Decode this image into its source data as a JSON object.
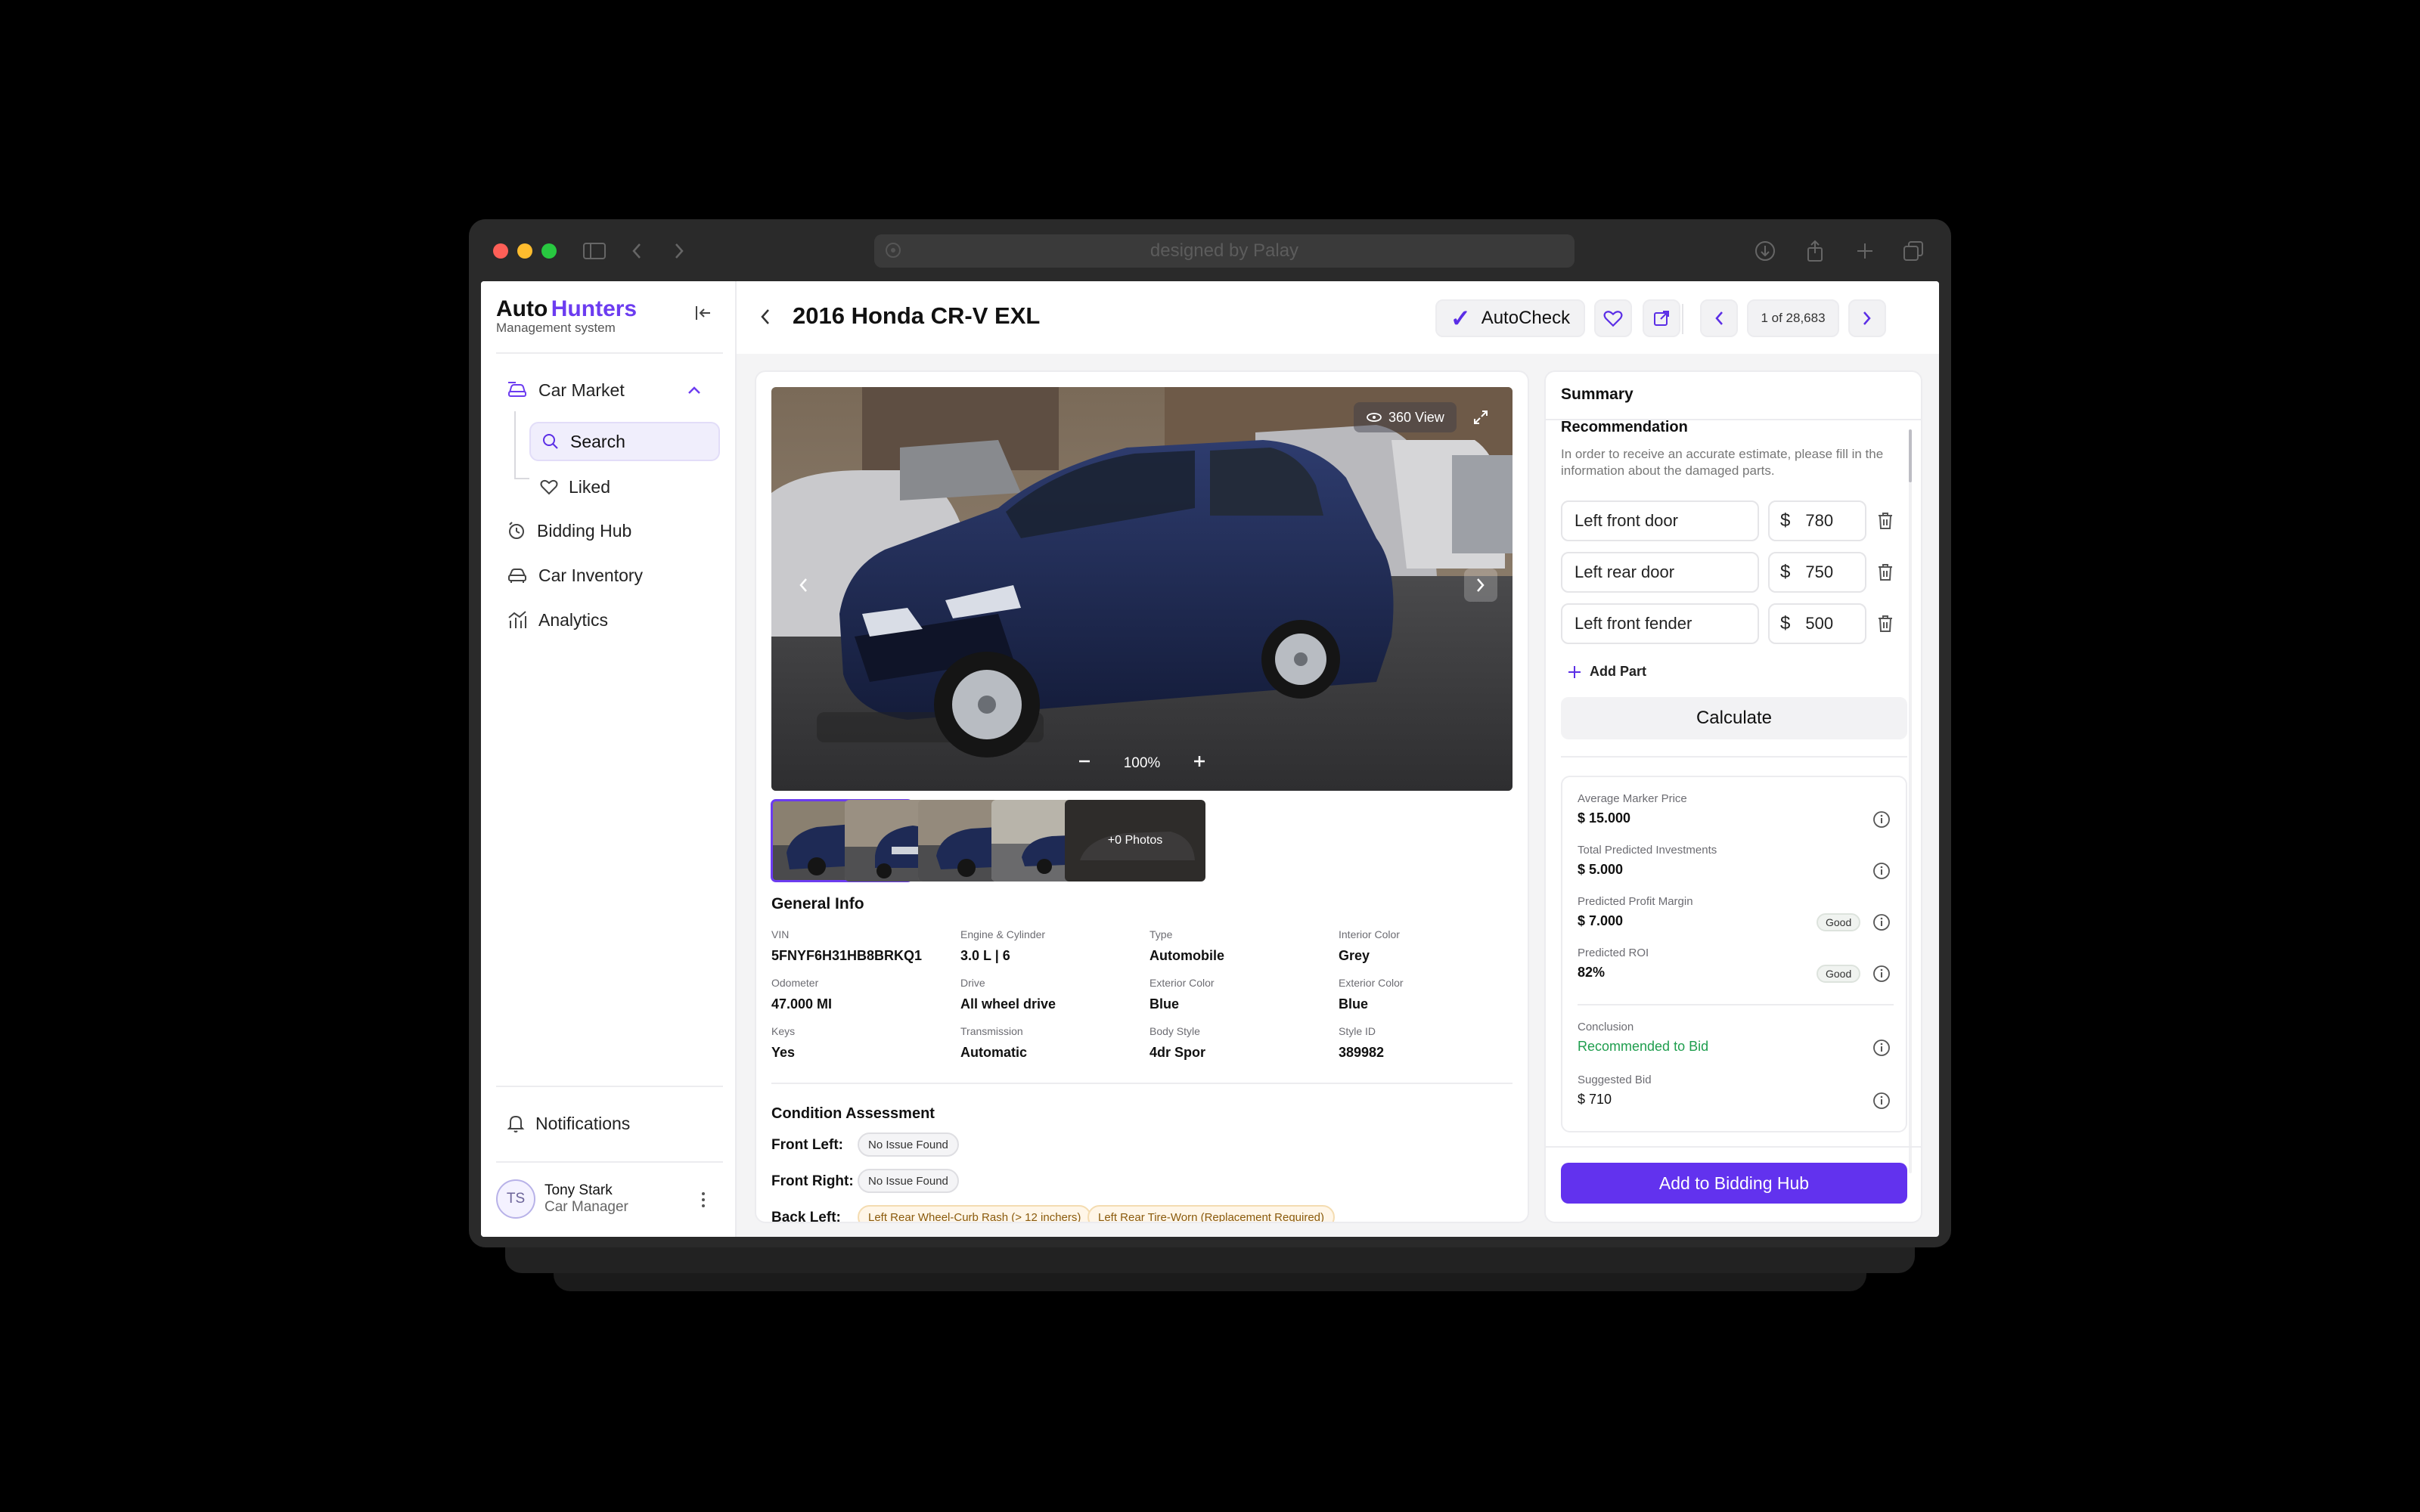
{
  "browser": {
    "url": "designed by Palay"
  },
  "brand": {
    "name_part1": "Auto",
    "name_part2": "Hunters",
    "subtitle": "Management system"
  },
  "nav": {
    "car_market": "Car Market",
    "search": "Search",
    "liked": "Liked",
    "bidding_hub": "Bidding Hub",
    "car_inventory": "Car Inventory",
    "analytics": "Analytics",
    "notifications": "Notifications"
  },
  "user": {
    "initials": "TS",
    "name": "Tony Stark",
    "role": "Car Manager"
  },
  "header": {
    "title": "2016 Honda CR-V EXL",
    "autocheck": "AutoCheck",
    "pager": "1 of 28,683"
  },
  "photo": {
    "view360": "360 View",
    "zoom": "100%",
    "more_photos": "+0 Photos"
  },
  "general_info": {
    "title": "General Info",
    "fields": [
      {
        "label": "VIN",
        "value": "5FNYF6H31HB8BRKQ1"
      },
      {
        "label": "Engine & Cylinder",
        "value": "3.0 L | 6"
      },
      {
        "label": "Type",
        "value": "Automobile"
      },
      {
        "label": "Interior Color",
        "value": "Grey"
      },
      {
        "label": "Odometer",
        "value": "47.000 MI"
      },
      {
        "label": "Drive",
        "value": "All wheel drive"
      },
      {
        "label": "Exterior Color",
        "value": "Blue"
      },
      {
        "label": "Exterior Color",
        "value": "Blue"
      },
      {
        "label": "Keys",
        "value": "Yes"
      },
      {
        "label": "Transmission",
        "value": "Automatic"
      },
      {
        "label": "Body Style",
        "value": "4dr Spor"
      },
      {
        "label": "Style ID",
        "value": "389982"
      }
    ]
  },
  "condition": {
    "title": "Condition Assessment",
    "rows": [
      {
        "label": "Front Left:",
        "chips": [
          "No Issue Found"
        ]
      },
      {
        "label": "Front Right:",
        "chips": [
          "No Issue Found"
        ]
      },
      {
        "label": "Back Left:",
        "chips": [
          "Left Rear Wheel-Curb Rash (> 12 inchers)",
          "Left Rear Tire-Worn (Replacement Required)"
        ]
      }
    ]
  },
  "summary": {
    "title": "Summary",
    "recommendation_title": "Recommendation",
    "recommendation_desc": "In order to receive an accurate estimate, please fill in the information about the damaged parts.",
    "parts": [
      {
        "name": "Left front door",
        "currency": "$",
        "cost": "780"
      },
      {
        "name": "Left rear door",
        "currency": "$",
        "cost": "750"
      },
      {
        "name": "Left front fender",
        "currency": "$",
        "cost": "500"
      }
    ],
    "add_part": "Add Part",
    "calculate": "Calculate",
    "metrics": [
      {
        "label": "Average Marker Price",
        "value": "$ 15.000"
      },
      {
        "label": "Total Predicted Investments",
        "value": "$ 5.000"
      },
      {
        "label": "Predicted Profit Margin",
        "value": "$ 7.000",
        "badge": "Good"
      },
      {
        "label": "Predicted ROI",
        "value": "82%",
        "badge": "Good"
      }
    ],
    "conclusion_label": "Conclusion",
    "conclusion_value": "Recommended to Bid",
    "suggested_label": "Suggested Bid",
    "suggested_value": "$ 710",
    "add_button": "Add to Bidding Hub"
  },
  "colors": {
    "accent": "#6232ee",
    "positive": "#1f9e4e",
    "car_body": "#1e2a55"
  }
}
